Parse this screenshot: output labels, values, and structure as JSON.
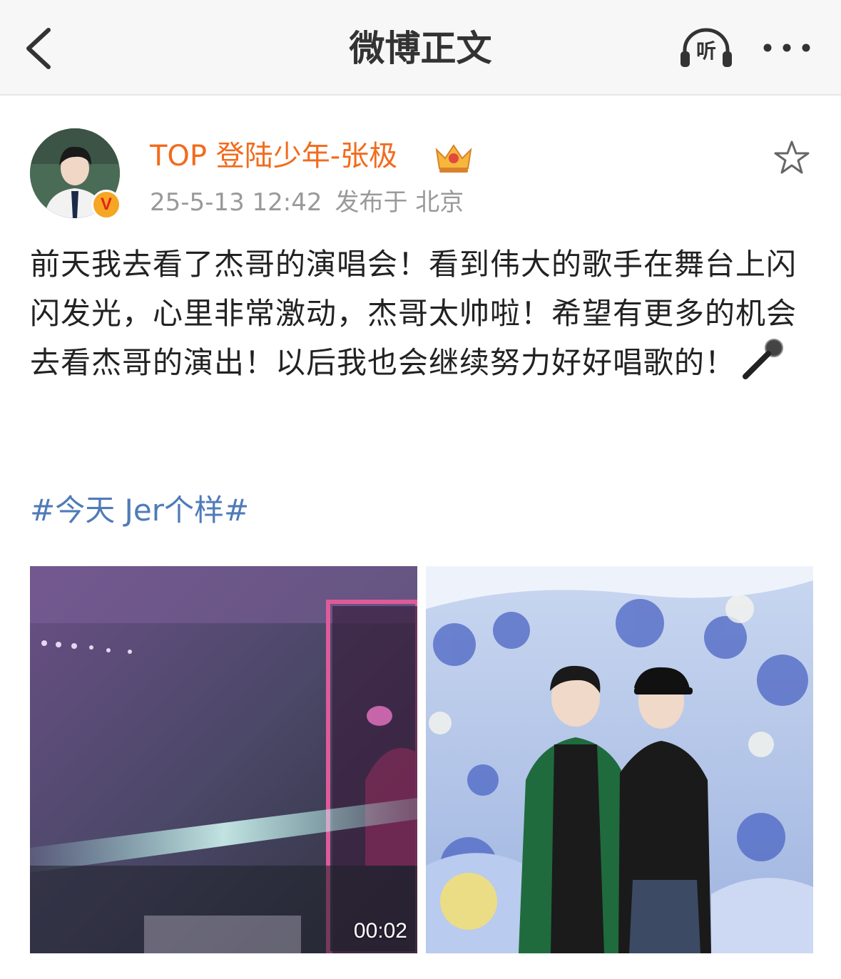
{
  "nav": {
    "title": "微博正文",
    "listen_label": "听"
  },
  "author": {
    "name": "TOP 登陆少年-张极",
    "verified_badge": "V",
    "time": "25-5-13 12:42",
    "location": "发布于 北京",
    "name_color": "#f26b1d"
  },
  "post": {
    "text": "前天我去看了杰哥的演唱会！看到伟大的歌手在舞台上闪闪发光，心里非常激动，杰哥太帅啦！希望有更多的机会去看杰哥的演出！以后我也会继续努力好好唱歌的！",
    "emoji": "microphone-emoji",
    "hashtag": "#今天 Jer个样#",
    "hashtag_color": "#4f7bb8"
  },
  "media": {
    "video_duration": "00:02"
  },
  "icons": [
    "back-arrow-icon",
    "headphones-icon",
    "more-icon",
    "crown-icon",
    "star-icon",
    "microphone-icon"
  ]
}
